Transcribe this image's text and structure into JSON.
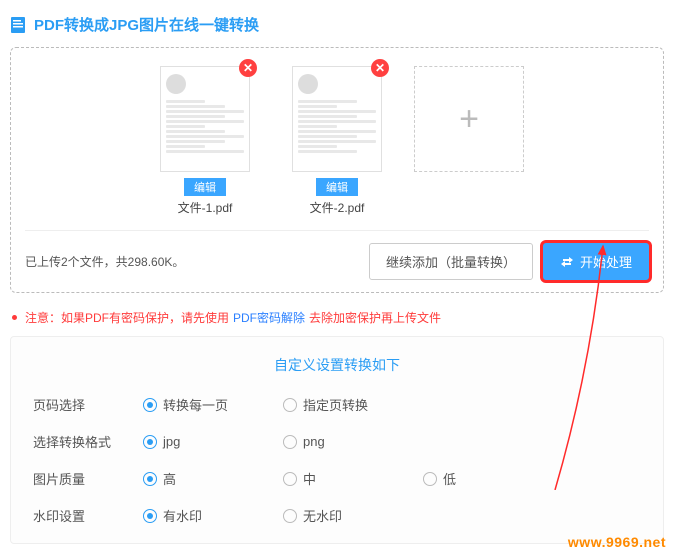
{
  "title": "PDF转换成JPG图片在线一键转换",
  "files": [
    {
      "name": "文件-1.pdf",
      "edit": "编辑"
    },
    {
      "name": "文件-2.pdf",
      "edit": "编辑"
    }
  ],
  "status": "已上传2个文件，共298.60K。",
  "buttons": {
    "continueAdd": "继续添加（批量转换）",
    "start": "开始处理"
  },
  "notice": {
    "prefix": "注意：如果PDF有密码保护，请先使用",
    "link": "PDF密码解除",
    "suffix": "去除加密保护再上传文件"
  },
  "settings": {
    "title": "自定义设置转换如下",
    "rows": [
      {
        "label": "页码选择",
        "options": [
          "转换每一页",
          "指定页转换"
        ],
        "selected": 0
      },
      {
        "label": "选择转换格式",
        "options": [
          "jpg",
          "png"
        ],
        "selected": 0
      },
      {
        "label": "图片质量",
        "options": [
          "高",
          "中",
          "低"
        ],
        "selected": 0
      },
      {
        "label": "水印设置",
        "options": [
          "有水印",
          "无水印"
        ],
        "selected": 0
      }
    ]
  },
  "watermark": "www.9969.net"
}
